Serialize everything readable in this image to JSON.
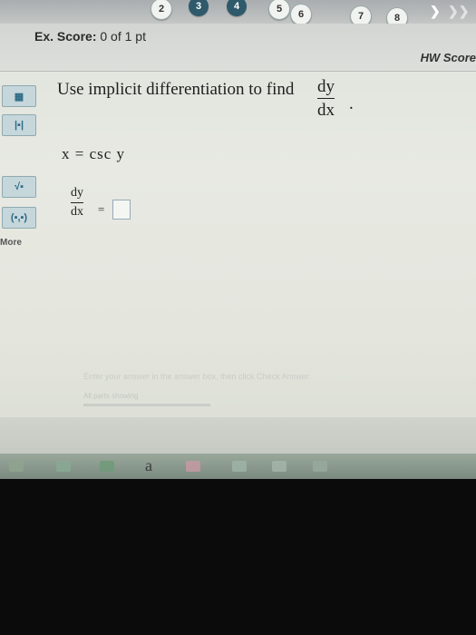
{
  "question_nav": {
    "numbers": [
      "2",
      "3",
      "4",
      "5",
      "6",
      "7",
      "8"
    ],
    "next_icon": "chevron-right-icon"
  },
  "score": {
    "ex_label": "Ex. Score:",
    "ex_value": "0 of 1 pt",
    "hw_label": "HW Score"
  },
  "sidebar": {
    "tools": [
      {
        "icon": "fraction-icon",
        "glyph": "▦"
      },
      {
        "icon": "absolute-value-icon",
        "glyph": "|▪|"
      },
      {
        "icon": "sqrt-icon",
        "glyph": "√▪"
      },
      {
        "icon": "ordered-pair-icon",
        "glyph": "(▪,▪)"
      }
    ],
    "more_label": "More"
  },
  "question": {
    "prompt": "Use implicit differentiation to find",
    "dy": "dy",
    "dx": "dx",
    "period": ".",
    "equation": "x = csc y",
    "answer_lhs_num": "dy",
    "answer_lhs_den": "dx",
    "equals": "=",
    "answer_value": ""
  },
  "footer": {
    "hint": "Enter your answer in the answer box, then click Check Answer.",
    "parts": "All parts showing"
  },
  "taskbar": {
    "letter": "a"
  }
}
